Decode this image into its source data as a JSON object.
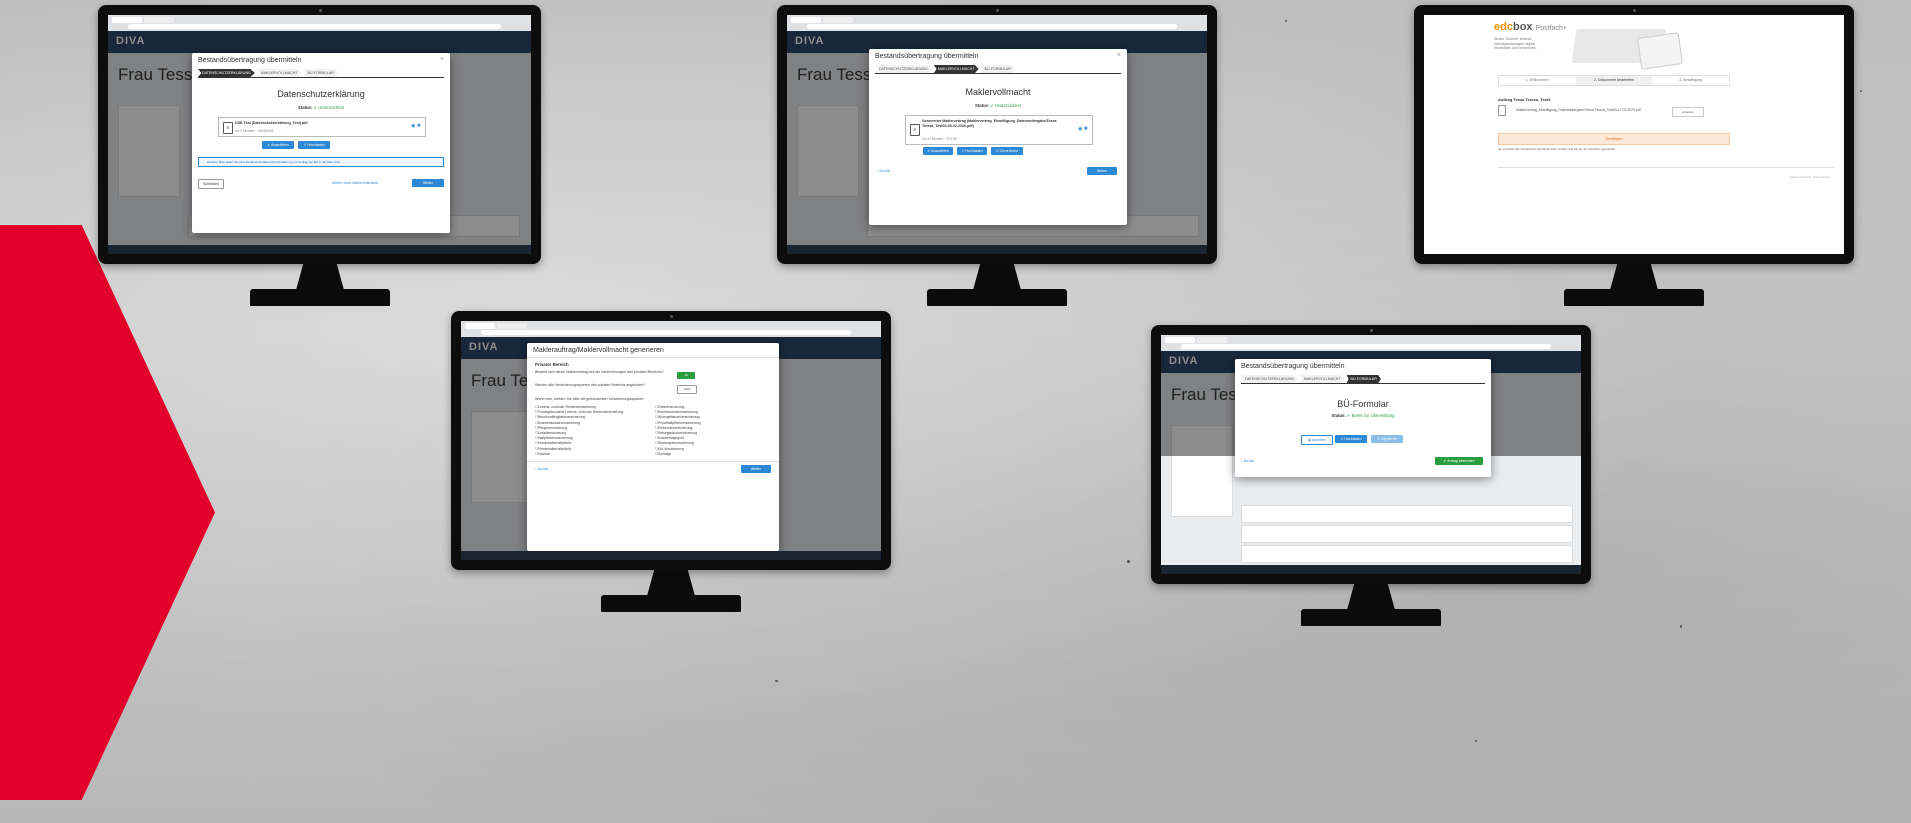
{
  "colors": {
    "accent_red": "#e3002b",
    "diva_navy": "#2c4a6b",
    "primary_blue": "#2d89d6",
    "success_green": "#2a9d3f",
    "edbox_orange": "#f39200",
    "notice_bg": "#fde8d7"
  },
  "monitor1": {
    "app_logo": "DIVA",
    "bg_title": "Frau Tessa-T",
    "modal_title": "Bestandsübertragung übermitteln",
    "steps": [
      "DATENSCHUTZERKLÄRUNG",
      "MAKLERVOLLMACHT",
      "BÜ-FORMULAR"
    ],
    "heading": "Datenschutzerklärung",
    "status_label": "Status:",
    "status_value": "Unterzeichnet",
    "file_name": "DSE-Test (Datenschutzerklärung_Test).pdf",
    "file_meta": "vor 2 Minuten · 145,506 kB",
    "btn_select": "Auswählen",
    "btn_upload": "Hochladen",
    "info_text": "Hinweis: Bitte laden Sie eine bestehende Datenschutzerklärung und Vertrag der BÜ in die Akte hoch",
    "btn_close": "Schließen",
    "link_next": "Weiter ohne Maklervollmacht",
    "btn_next": "Weiter"
  },
  "monitor2": {
    "app_logo": "DIVA",
    "bg_title": "Frau Tessa-T",
    "modal_title": "Bestandsübertragung übermitteln",
    "steps": [
      "DATENSCHUTZERKLÄRUNG",
      "MAKLERVOLLMACHT",
      "BÜ-FORMULAR"
    ],
    "heading": "Maklervollmacht",
    "status_label": "Status:",
    "status_value": "Unterzeichnet",
    "file_name": "Generierter Maklervertrag (Maklervertrag_Einwilligung_Datenweitergabe/Tessa Teresa_Test03-09-02-2020.pdf)",
    "file_meta": "vor 44 Minuten · 72,3 kB",
    "btn_select": "Auswählen",
    "btn_upload": "Hochladen",
    "btn_generate": "Generieren",
    "link_back": "Zurück",
    "btn_next": "Weiter"
  },
  "monitor3": {
    "logo_prefix": "edc",
    "logo_suffix": "box",
    "logo_product": "Postfach+",
    "intro_line1": "Sicher. Schnell. Überall.",
    "intro_line2": "Vertragsunterlagen digital",
    "intro_line3": "bearbeiten und versenden.",
    "tabs": [
      "1. Willkommen",
      "2. Dokumente bearbeiten",
      "3. Bestätigung"
    ],
    "section_title": "Auftrag Tessa Teresa_Test3",
    "doc_name": "Maklervertrag_Einwilligung_Datenweitergabe/Tessa Teresa_Test03-17.02.2020.pdf",
    "doc_button": "Ansehen",
    "notice": "Bestätigen",
    "footnote": "Ja, ich habe alle Dokumente bearbeitet bzw. erstellt, und bin an die Verfahren gebunden.",
    "footer": "edcbox Postfach+ Informationen"
  },
  "monitor4": {
    "app_logo": "DIVA",
    "bg_title": "Frau Tessa-T",
    "modal_title": "Maklerauftrag/Maklervollmacht generieren",
    "section": "Privater Bereich",
    "q1": "Besteht sich dieser Maklervertrag auf die Versicherungen des privaten Bereichs?",
    "q1_toggle": "JA",
    "q2": "Werden alle Versicherungssparten des privaten Bereichs angeboten?",
    "q2_toggle": "NEIN",
    "q3": "Wenn nein, wählen Sie bitte die gewünschten Versicherungssparten:",
    "checkboxes_left": [
      "Lebens- und/oder Rentenversicherung",
      "Fondsgebundene Lebens- und/oder Rentenversicherung",
      "Berufsunfähigkeitsversicherung",
      "Krankenzusatzversicherung",
      "Pflegeversicherung",
      "Unfallversicherung",
      "Haftpflichtversicherung",
      "Hundehalterhaftpflicht",
      "Pferdehalterhaftpflicht",
      "Hausrat"
    ],
    "checkboxes_right": [
      "Glasversicherung",
      "Rechtsschutzversicherung",
      "Wohngebäudeversicherung",
      "Privathaftpflichtversicherung",
      "Elektronikversicherung",
      "Reisegepäckversicherung",
      "Krankentagegeld",
      "Sterbegeldversicherung",
      "Kfz-Versicherung",
      "Sonstige"
    ],
    "link_back": "Zurück",
    "btn_next": "Weiter"
  },
  "monitor5": {
    "app_logo": "DIVA",
    "bg_title": "Frau Tessa-T",
    "modal_title": "Bestandsübertragung übermitteln",
    "steps": [
      "DATENSCHUTZERKLÄRUNG",
      "MAKLERVOLLMACHT",
      "BÜ-FORMULAR"
    ],
    "heading": "BÜ-Formular",
    "status_label": "Status:",
    "status_value": "Bereit zur Übermittlung",
    "btn_view": "Ansehen",
    "btn_upload": "Hochladen",
    "btn_sign": "Signieren",
    "link_back": "Zurück",
    "btn_submit": "Antrag absenden"
  }
}
